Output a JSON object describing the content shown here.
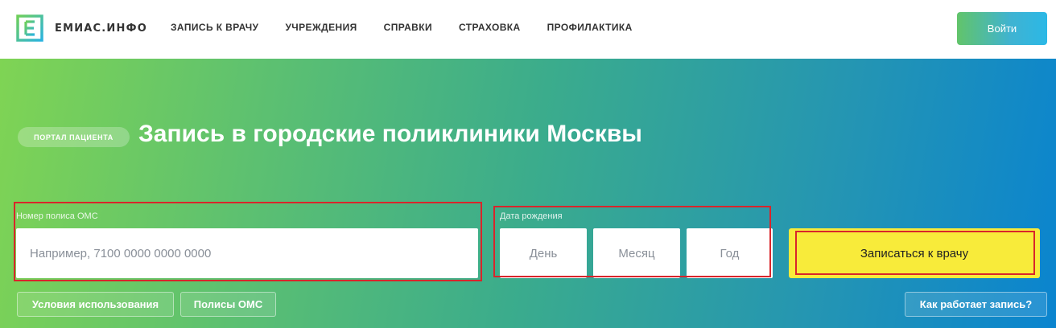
{
  "header": {
    "logo_text": "ЕМИАС.ИНФО",
    "nav": [
      "ЗАПИСЬ К ВРАЧУ",
      "УЧРЕЖДЕНИЯ",
      "СПРАВКИ",
      "СТРАХОВКА",
      "ПРОФИЛАКТИКА"
    ],
    "login_label": "Войти"
  },
  "hero": {
    "badge": "ПОРТАЛ ПАЦИЕНТА",
    "title": "Запись в городские поликлиники Москвы"
  },
  "form": {
    "policy_label": "Номер полиса ОМС",
    "policy_placeholder": "Например, 7100 0000 0000 0000",
    "birth_label": "Дата рождения",
    "day_placeholder": "День",
    "month_placeholder": "Месяц",
    "year_placeholder": "Год",
    "submit_label": "Записаться к врачу"
  },
  "links": {
    "terms": "Условия использования",
    "policies": "Полисы ОМС",
    "how_it_works": "Как работает запись?"
  },
  "colors": {
    "accent_yellow": "#f8eb3a",
    "highlight_red": "#d9252b",
    "logo_green": "#4cc46a",
    "logo_blue": "#2ab3e0"
  }
}
